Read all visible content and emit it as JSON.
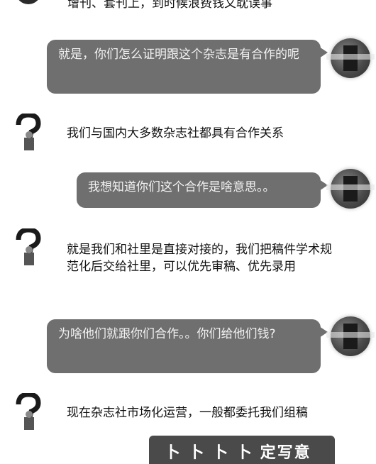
{
  "chat": {
    "top_partial_text": "增刊、套刊上，到时候浪费钱又耽误事",
    "messages": [
      {
        "side": "right",
        "text": "就是，你们怎么证明跟这个杂志是有合作的呢"
      },
      {
        "side": "left",
        "text": "我们与国内大多数杂志社都具有合作关系"
      },
      {
        "side": "right",
        "text": "我想知道你们这个合作是啥意思。。"
      },
      {
        "side": "left",
        "text": "就是我们和社里是直接对接的，我们把稿件学术规范化后交给社里，可以优先审稿、优先录用"
      },
      {
        "side": "right",
        "text": "为啥他们就跟你们合作。。你们给他们钱?"
      },
      {
        "side": "left",
        "text": "现在杂志社市场化运营，一般都委托我们组稿"
      }
    ],
    "bottom_banner_text": "卜 卜 卜 卜   定写意"
  }
}
